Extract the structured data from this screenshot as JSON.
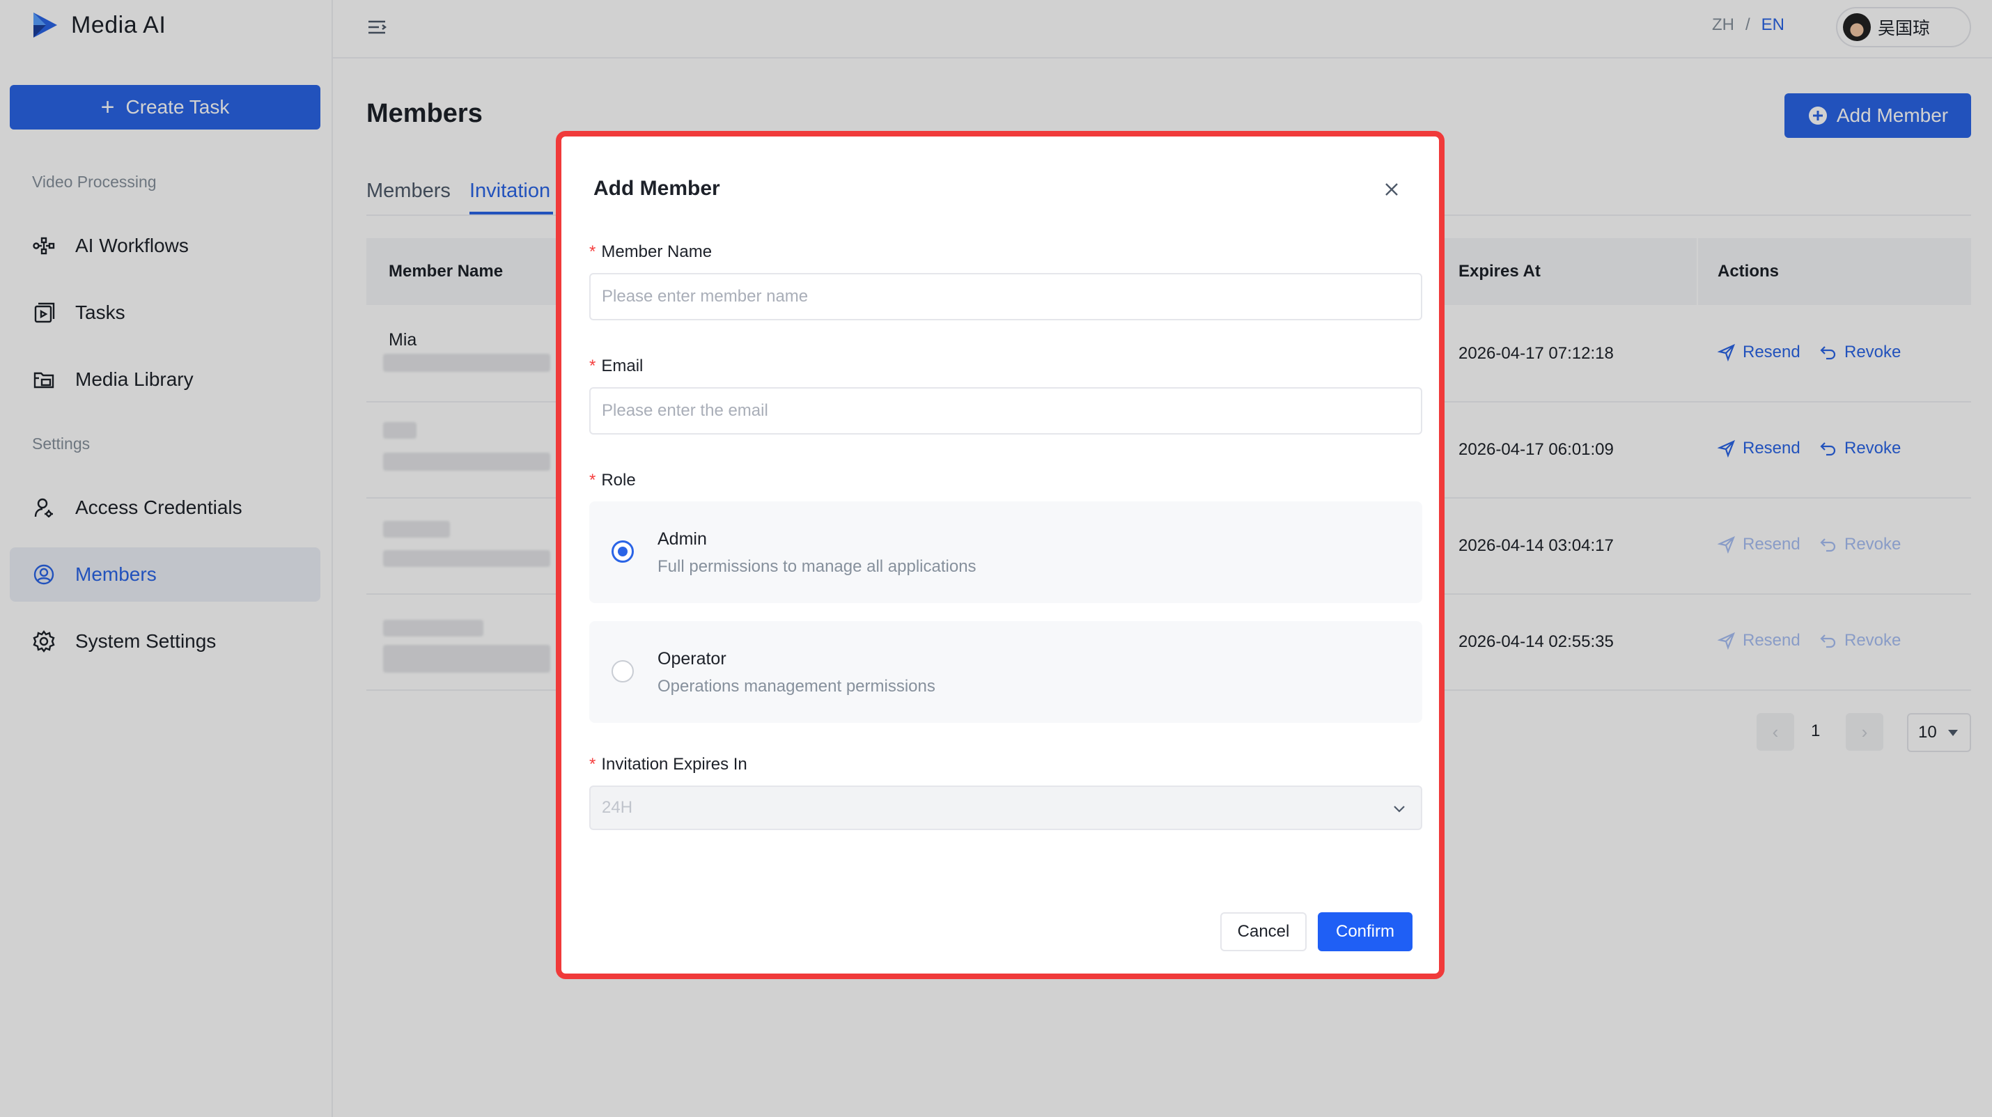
{
  "app": {
    "name": "Media AI"
  },
  "sidebar": {
    "create_task": "Create Task",
    "section_video": "Video Processing",
    "section_settings": "Settings",
    "items": [
      {
        "label": "AI Workflows"
      },
      {
        "label": "Tasks"
      },
      {
        "label": "Media Library"
      },
      {
        "label": "Access Credentials"
      },
      {
        "label": "Members"
      },
      {
        "label": "System Settings"
      }
    ]
  },
  "topbar": {
    "lang_zh": "ZH",
    "lang_sep": "/",
    "lang_en": "EN",
    "user_name": "吴国琼"
  },
  "main": {
    "title": "Members",
    "add_member": "Add Member",
    "tabs": [
      {
        "label": "Members"
      },
      {
        "label": "Invitation"
      }
    ],
    "columns": {
      "name": "Member Name",
      "expires": "Expires At",
      "actions": "Actions"
    },
    "rows": [
      {
        "name": "Mia",
        "expires": "2026-04-17 07:12:18",
        "resend": "Resend",
        "revoke": "Revoke"
      },
      {
        "name": "",
        "expires": "2026-04-17 06:01:09",
        "resend": "Resend",
        "revoke": "Revoke"
      },
      {
        "name": "",
        "expires": "2026-04-14 03:04:17",
        "resend": "Resend",
        "revoke": "Revoke"
      },
      {
        "name": "",
        "expires": "2026-04-14 02:55:35",
        "resend": "Resend",
        "revoke": "Revoke"
      }
    ],
    "pagination": {
      "current": "1",
      "page_size": "10"
    }
  },
  "modal": {
    "title": "Add Member",
    "name_label": "Member Name",
    "name_placeholder": "Please enter member name",
    "email_label": "Email",
    "email_placeholder": "Please enter the email",
    "role_label": "Role",
    "roles": [
      {
        "title": "Admin",
        "desc": "Full permissions to manage all applications",
        "selected": true
      },
      {
        "title": "Operator",
        "desc": "Operations management permissions",
        "selected": false
      }
    ],
    "expires_label": "Invitation Expires In",
    "expires_value": "24H",
    "cancel": "Cancel",
    "confirm": "Confirm"
  },
  "colors": {
    "primary": "#2a64e6",
    "highlight_border": "#f03a3a",
    "required": "#f53f3f"
  }
}
